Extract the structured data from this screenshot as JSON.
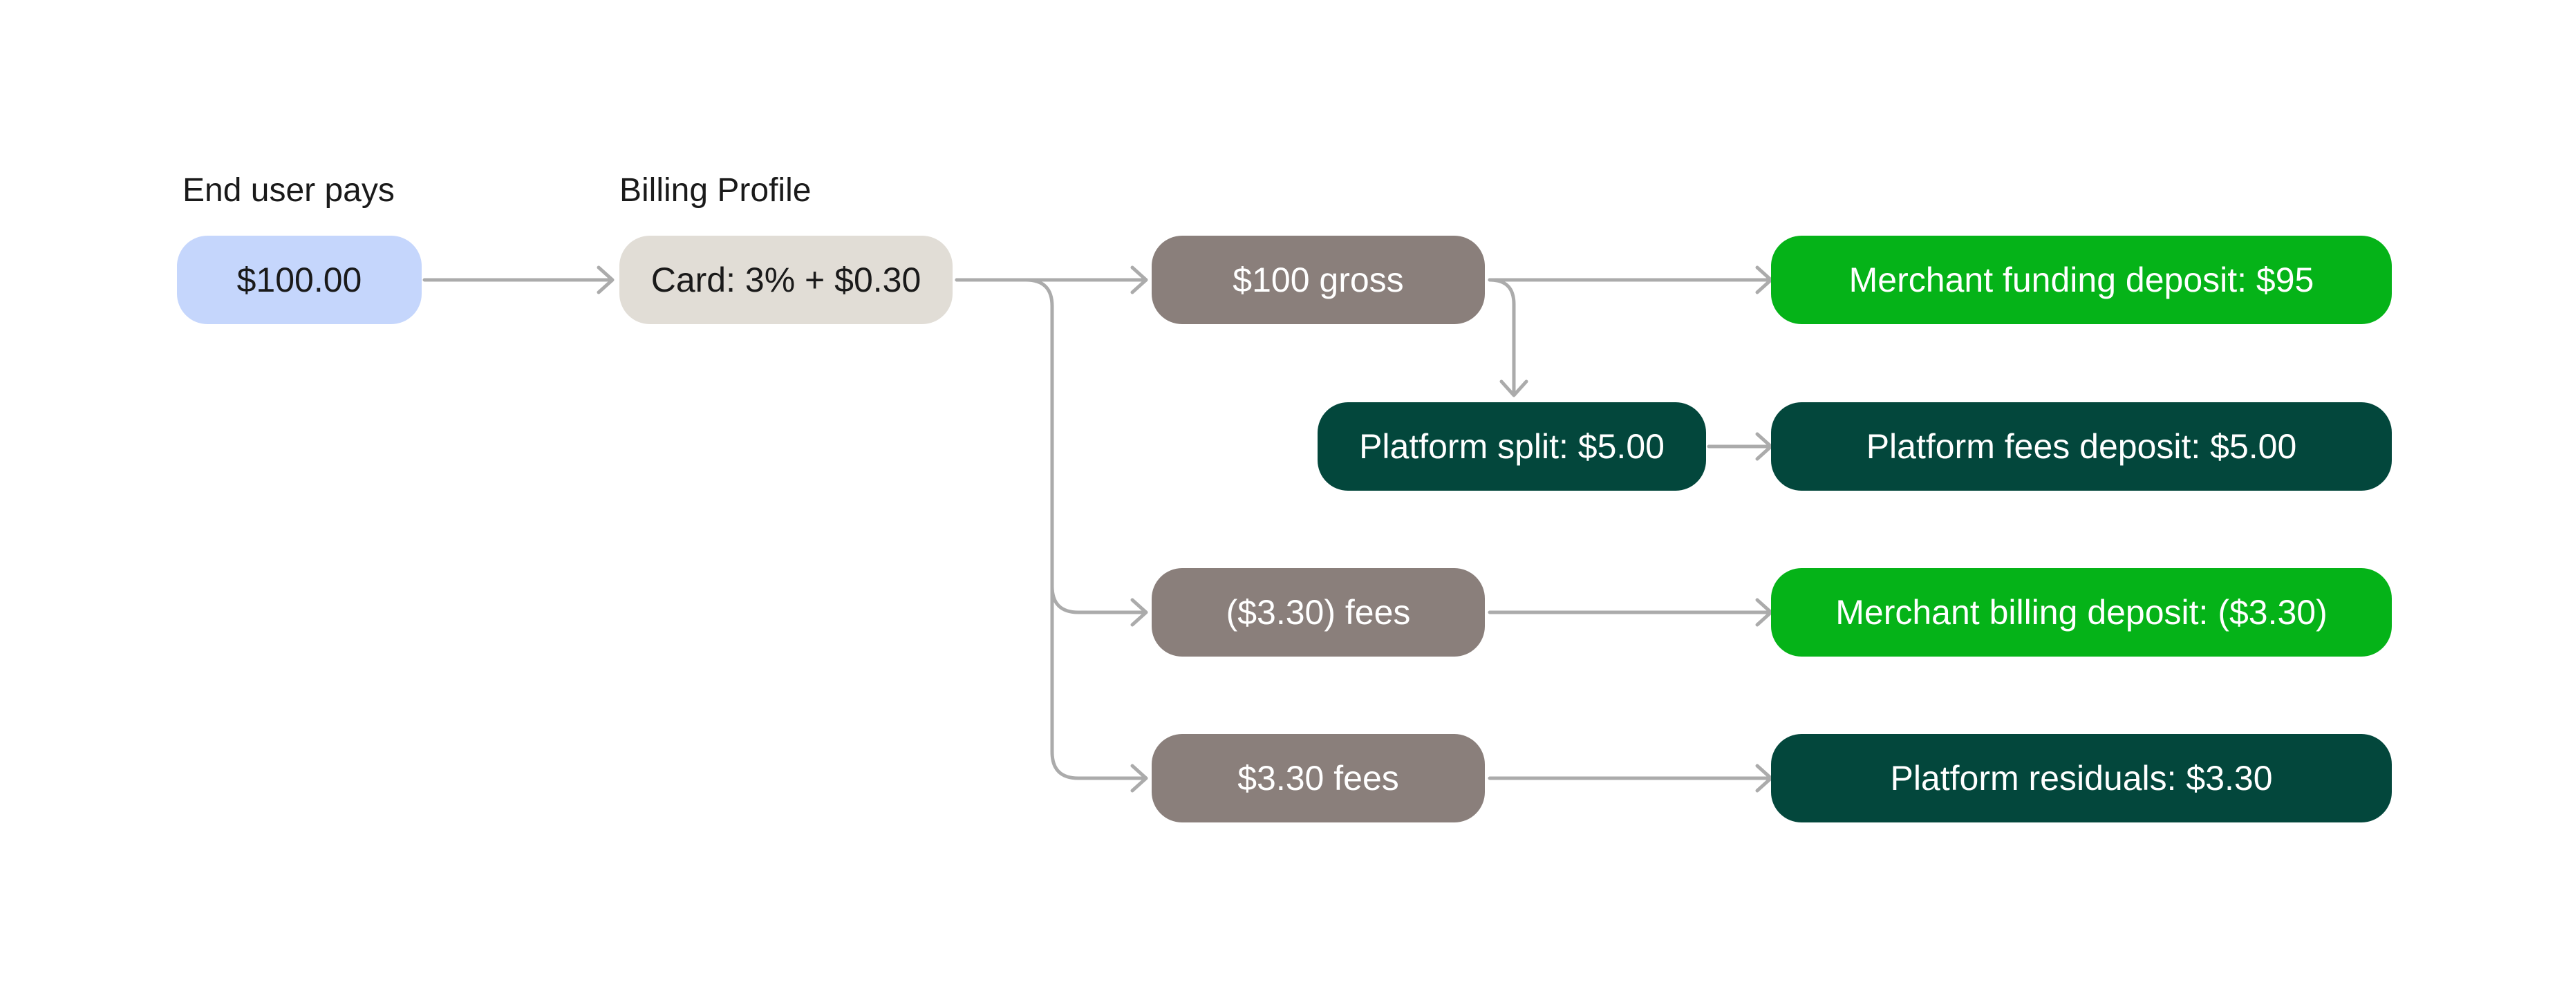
{
  "headers": {
    "end_user": "End user pays",
    "billing_profile": "Billing Profile"
  },
  "nodes": {
    "payment": "$100.00",
    "card_fee": "Card: 3% + $0.30",
    "gross": "$100 gross",
    "merchant_funding": "Merchant funding deposit: $95",
    "platform_split": "Platform split: $5.00",
    "platform_fees_deposit": "Platform fees deposit: $5.00",
    "negative_fees": "($3.30) fees",
    "merchant_billing": "Merchant billing deposit: ($3.30)",
    "positive_fees": "$3.30 fees",
    "platform_residuals": "Platform residuals: $3.30"
  },
  "colors": {
    "payment": "#c5d6fc",
    "billing": "#e1ddd6",
    "intermediate": "#8a7f7b",
    "merchant_deposit": "#05b318",
    "platform_deposit": "#03473c",
    "connector": "#ababab"
  }
}
